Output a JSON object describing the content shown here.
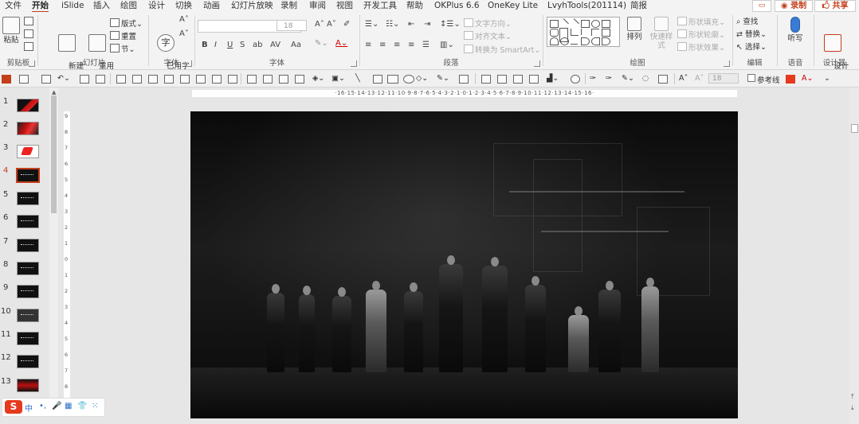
{
  "menubar": {
    "tabs": [
      {
        "label": "文件",
        "active": false
      },
      {
        "label": "开始",
        "active": true
      },
      {
        "label": "iSlide",
        "active": false
      },
      {
        "label": "插入",
        "active": false
      },
      {
        "label": "绘图",
        "active": false
      },
      {
        "label": "设计",
        "active": false
      },
      {
        "label": "切换",
        "active": false
      },
      {
        "label": "动画",
        "active": false
      },
      {
        "label": "幻灯片放映",
        "active": false
      },
      {
        "label": "录制",
        "active": false
      },
      {
        "label": "审阅",
        "active": false
      },
      {
        "label": "视图",
        "active": false
      },
      {
        "label": "开发工具",
        "active": false
      },
      {
        "label": "帮助",
        "active": false
      },
      {
        "label": "OKPlus 6.6",
        "active": false
      },
      {
        "label": "OneKey Lite",
        "active": false
      },
      {
        "label": "LvyhTools(201114)",
        "active": false
      },
      {
        "label": "简报",
        "active": false
      }
    ],
    "comment_icon": "comment-icon",
    "record_label": "◉ 录制",
    "share_label": "🖒 共享"
  },
  "ribbon": {
    "clipboard": {
      "label": "剪贴板",
      "paste": "粘贴"
    },
    "slides": {
      "label": "幻灯片",
      "new_slide": "新建\n幻灯片",
      "reuse": "重用\n幻灯片",
      "layout": "版式",
      "reset": "重置",
      "section": "节"
    },
    "font_glyph": {
      "label": "字体",
      "icon_text": "字",
      "button": "已用字\n体"
    },
    "font": {
      "label": "字体",
      "size": "18",
      "bold": "B",
      "italic": "I",
      "underline": "U",
      "strike": "S",
      "shadow": "ab",
      "spacing": "AV",
      "case": "Aa"
    },
    "paragraph": {
      "label": "段落",
      "text_direction": "文字方向",
      "align_text": "对齐文本",
      "smartart": "转换为 SmartArt"
    },
    "drawing": {
      "label": "绘图",
      "arrange": "排列",
      "quick_styles": "快速样式",
      "shape_fill": "形状填充",
      "shape_outline": "形状轮廓",
      "shape_effects": "形状效果"
    },
    "editing": {
      "label": "编辑",
      "find": "查找",
      "replace": "替换",
      "select": "选择"
    },
    "voice": {
      "label": "语音",
      "dictate": "听写"
    },
    "designer": {
      "label": "设计器",
      "designer": "设计\n器"
    }
  },
  "qat": {
    "size": "18",
    "guides_label": "参考线"
  },
  "thumbnails": {
    "numbers": [
      "1",
      "2",
      "3",
      "4",
      "5",
      "6",
      "7",
      "8",
      "9",
      "10",
      "11",
      "12",
      "13"
    ],
    "selected": "4"
  },
  "rulers": {
    "horizontal": "·16·15·14·13·12·11·10·9·8·7·6·5·4·3·2·1·0·1·2·3·4·5·6·7·8·9·10·11·12·13·14·15·16·",
    "vertical": [
      "9",
      "8",
      "7",
      "6",
      "5",
      "4",
      "3",
      "2",
      "1",
      "0",
      "1",
      "2",
      "3",
      "4",
      "5",
      "6",
      "7",
      "8",
      "9"
    ]
  },
  "ime": {
    "logo": "S",
    "mode": "中",
    "items": [
      "•,",
      "🎤",
      "▦",
      "👕",
      "⁙"
    ]
  },
  "colors": {
    "accent": "#c43e1c",
    "ribbon_bg": "#f3f3f3",
    "workspace": "#e6e6e6",
    "slide_bg": "#111111"
  }
}
